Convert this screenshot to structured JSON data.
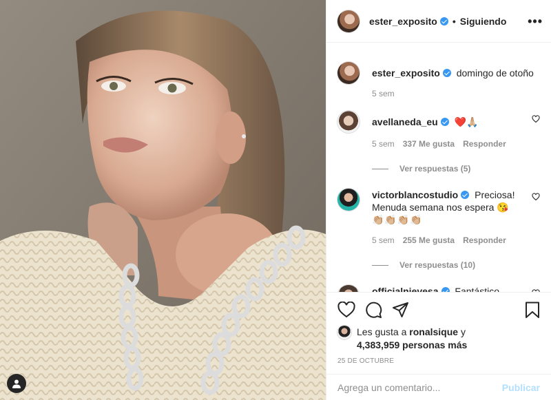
{
  "post": {
    "username": "ester_exposito",
    "follow_status": "Siguiendo",
    "separator": "•",
    "more_label": "•••"
  },
  "caption": {
    "username": "ester_exposito",
    "text": "domingo de otoño",
    "time": "5 sem"
  },
  "comments": [
    {
      "username": "avellaneda_eu",
      "text": "❤️🙏🏼",
      "time": "5 sem",
      "likes": "337 Me gusta",
      "reply_label": "Responder",
      "view_replies": "Ver respuestas (5)"
    },
    {
      "username": "victorblancostudio",
      "text": "Preciosa! Menuda semana nos espera 😘",
      "text2": "👏🏼👏🏼👏🏼👏🏼",
      "time": "5 sem",
      "likes": "255 Me gusta",
      "reply_label": "Responder",
      "view_replies": "Ver respuestas (10)"
    },
    {
      "username": "officialnievesa",
      "text": "Fantástico"
    }
  ],
  "likes": {
    "prefix": "Les gusta a",
    "user": "ronalsique",
    "joiner": "y",
    "count": "4,383,959 personas más"
  },
  "date": "25 DE OCTUBRE",
  "comment_box": {
    "placeholder": "Agrega un comentario...",
    "post_label": "Publicar"
  },
  "colors": {
    "verified": "#3897f0",
    "publish_disabled": "#b2dffc",
    "text_primary": "#262626",
    "text_secondary": "#8e8e8e"
  },
  "icons": [
    "heart-icon",
    "comment-icon",
    "share-icon",
    "bookmark-icon",
    "more-options-icon",
    "verified-badge-icon",
    "user-tag-icon"
  ]
}
